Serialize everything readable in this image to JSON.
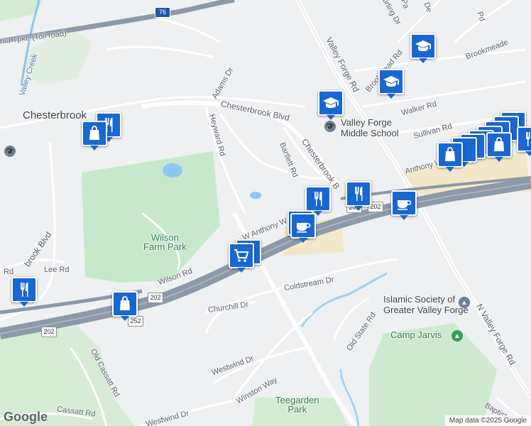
{
  "roads": {
    "pa_tpke": "nia Tpke (Toll road)",
    "adams": "Adams Dr",
    "heyward": "Heyward Rd",
    "chesterbrook_n": "Chesterbrook Blvd",
    "chesterbrook_e": "Chesterbrook B",
    "bartlett": "Bartlett Rd",
    "valley_forge": "Valley Forge Rd",
    "n_valley_forge": "N Valley Forge Rd",
    "walker": "Walker Rd",
    "sullivan": "Sullivan Rd",
    "anthony": "Anthony W",
    "w_anthony": "W Anthony W",
    "brookmead": "Brookmead Rd",
    "brookmeade": "Brookmeade",
    "stirling": "Stirling Dr",
    "pd": "Pd",
    "pa": "Pa",
    "de": "De",
    "lee": "Lee Rd",
    "wilson": "Wilson Rd",
    "chesterbrook_w": "brook Blvd",
    "rd_w": "Rd",
    "churchill": "Churchill Dr",
    "coldstream": "Coldstream Dr",
    "old_state": "Old State Rd",
    "westwind": "Westwind Dr",
    "westwind2": "Westwind Dr",
    "winston": "Winston Way",
    "old_cassatt": "Old Cassatt Rd",
    "cassatt": "Cassatt Rd",
    "baptist": "Baptist Rd",
    "valley_creek": "Valley Creek"
  },
  "shields": {
    "i76": "76",
    "us202_a": "202",
    "us202_b": "202",
    "us202_c": "202",
    "us202_d": "202",
    "us252": "252"
  },
  "places": {
    "chesterbrook": "Chesterbrook",
    "wilson_park": "Wilson\nFarm Park",
    "middle_school": "Valley Forge\nMiddle School",
    "islamic": "Islamic Society of\nGreater Valley Forge",
    "camp_jarvis": "Camp Jarvis",
    "teegarden": "Teegarden\nPark"
  },
  "footer": {
    "logo": "Google",
    "attribution": "Map data ©2025 Google"
  },
  "colors": {
    "highway": "#8c99a8",
    "park": "#c7e8cb",
    "water": "#8ec7ef",
    "pin": "#1967d2",
    "commercial": "#f2e8c9"
  }
}
